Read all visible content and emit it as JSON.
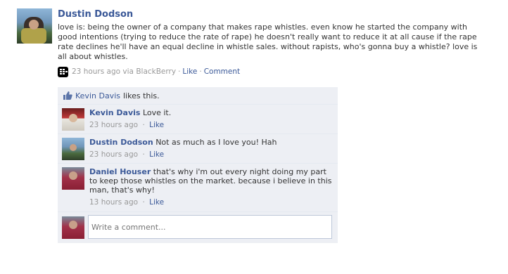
{
  "story": {
    "actor": "Dustin Dodson",
    "message": "love is: being the owner of a company that makes rape whistles. even know he started the company with good intentions (trying to reduce the rate of rape) he doesn't really want to reduce it at all cause if the rape rate declines he'll have an equal decline in whistle sales. without rapists, who's gonna buy a whistle? love is all about whistles.",
    "timestamp": "23 hours ago via BlackBerry",
    "dot": "·",
    "like_label": "Like",
    "comment_label": "Comment",
    "source_icon": "blackberry-icon"
  },
  "likes": {
    "name": "Kevin Davis",
    "suffix": "likes this."
  },
  "comments": [
    {
      "author": "Kevin Davis",
      "text": "Love it.",
      "time": "23 hours ago",
      "like_label": "Like"
    },
    {
      "author": "Dustin Dodson",
      "text": "Not as much as I love you! Hah",
      "time": "23 hours ago",
      "like_label": "Like"
    },
    {
      "author": "Daniel Houser",
      "text": "that's why i'm out every night doing my part to keep those whistles on the market. because i believe in this man, that's why!",
      "time": "13 hours ago",
      "like_label": "Like"
    }
  ],
  "composer": {
    "placeholder": "Write a comment..."
  },
  "colors": {
    "link": "#3b5998",
    "ufi_bg": "#edeff4",
    "meta": "#999999"
  }
}
